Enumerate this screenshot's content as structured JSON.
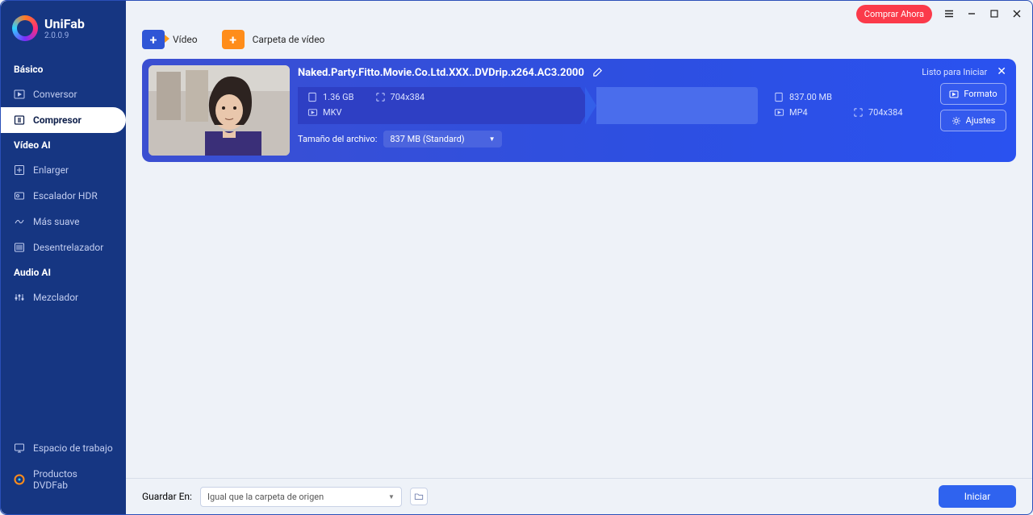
{
  "brand": {
    "name": "UniFab",
    "version": "2.0.0.9"
  },
  "sidebar": {
    "sections": [
      {
        "title": "Básico",
        "items": [
          {
            "label": "Conversor"
          },
          {
            "label": "Compresor"
          }
        ]
      },
      {
        "title": "Vídeo AI",
        "items": [
          {
            "label": "Enlarger"
          },
          {
            "label": "Escalador HDR"
          },
          {
            "label": "Más suave"
          },
          {
            "label": "Desentrelazador"
          }
        ]
      },
      {
        "title": "Audio AI",
        "items": [
          {
            "label": "Mezclador"
          }
        ]
      }
    ],
    "bottom": [
      {
        "label": "Espacio de trabajo"
      },
      {
        "label": "Productos DVDFab"
      }
    ]
  },
  "titlebar": {
    "buy_now": "Comprar Ahora"
  },
  "toolbar": {
    "video": "Vídeo",
    "folder": "Carpeta de vídeo"
  },
  "card": {
    "title": "Naked.Party.Fitto.Movie.Co.Ltd.XXX..DVDrip.x264.AC3.2000",
    "status": "Listo para Iniciar",
    "src": {
      "size": "1.36 GB",
      "format": "MKV",
      "res": "704x384"
    },
    "dst": {
      "size": "837.00 MB",
      "format": "MP4",
      "res": "704x384"
    },
    "filesize_label": "Tamaño del archivo:",
    "filesize_value": "837 MB (Standard)",
    "btn_format": "Formato",
    "btn_settings": "Ajustes"
  },
  "bottom": {
    "save_label": "Guardar En:",
    "save_value": "Igual que la carpeta de origen",
    "start": "Iniciar"
  }
}
